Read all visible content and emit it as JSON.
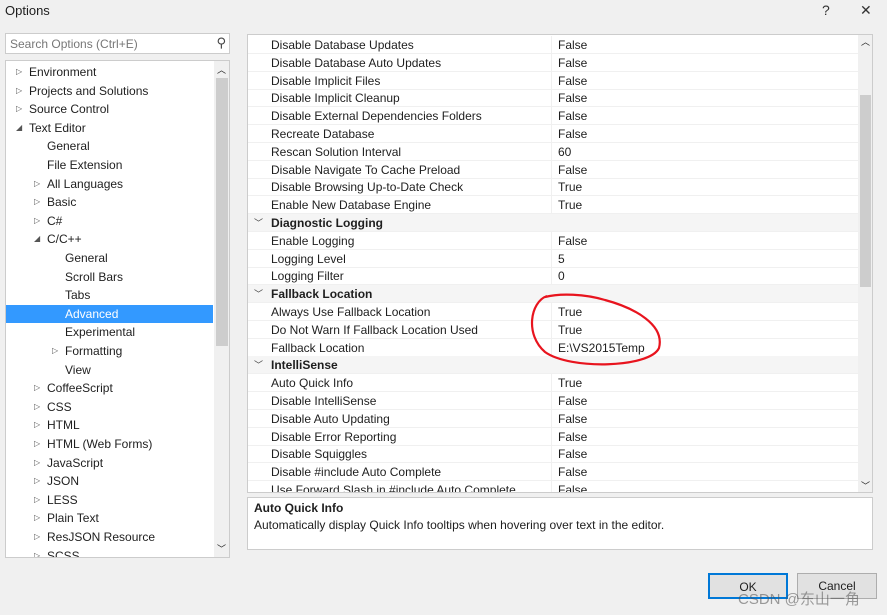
{
  "window": {
    "title": "Options",
    "help": "?",
    "close": "✕"
  },
  "search": {
    "placeholder": "Search Options (Ctrl+E)"
  },
  "tree": [
    {
      "label": "Environment",
      "level": 0,
      "state": "collapsed"
    },
    {
      "label": "Projects and Solutions",
      "level": 0,
      "state": "collapsed"
    },
    {
      "label": "Source Control",
      "level": 0,
      "state": "collapsed"
    },
    {
      "label": "Text Editor",
      "level": 0,
      "state": "expanded"
    },
    {
      "label": "General",
      "level": 1,
      "state": "leaf"
    },
    {
      "label": "File Extension",
      "level": 1,
      "state": "leaf"
    },
    {
      "label": "All Languages",
      "level": 1,
      "state": "collapsed"
    },
    {
      "label": "Basic",
      "level": 1,
      "state": "collapsed"
    },
    {
      "label": "C#",
      "level": 1,
      "state": "collapsed"
    },
    {
      "label": "C/C++",
      "level": 1,
      "state": "expanded"
    },
    {
      "label": "General",
      "level": 2,
      "state": "leaf"
    },
    {
      "label": "Scroll Bars",
      "level": 2,
      "state": "leaf"
    },
    {
      "label": "Tabs",
      "level": 2,
      "state": "leaf"
    },
    {
      "label": "Advanced",
      "level": 2,
      "state": "leaf",
      "selected": true
    },
    {
      "label": "Experimental",
      "level": 2,
      "state": "leaf"
    },
    {
      "label": "Formatting",
      "level": 2,
      "state": "collapsed"
    },
    {
      "label": "View",
      "level": 2,
      "state": "leaf"
    },
    {
      "label": "CoffeeScript",
      "level": 1,
      "state": "collapsed"
    },
    {
      "label": "CSS",
      "level": 1,
      "state": "collapsed"
    },
    {
      "label": "HTML",
      "level": 1,
      "state": "collapsed"
    },
    {
      "label": "HTML (Web Forms)",
      "level": 1,
      "state": "collapsed"
    },
    {
      "label": "JavaScript",
      "level": 1,
      "state": "collapsed"
    },
    {
      "label": "JSON",
      "level": 1,
      "state": "collapsed"
    },
    {
      "label": "LESS",
      "level": 1,
      "state": "collapsed"
    },
    {
      "label": "Plain Text",
      "level": 1,
      "state": "collapsed"
    },
    {
      "label": "ResJSON Resource",
      "level": 1,
      "state": "collapsed"
    },
    {
      "label": "SCSS",
      "level": 1,
      "state": "collapsed"
    }
  ],
  "grid": [
    {
      "name": "Disable Database Updates",
      "value": "False"
    },
    {
      "name": "Disable Database Auto Updates",
      "value": "False"
    },
    {
      "name": "Disable Implicit Files",
      "value": "False"
    },
    {
      "name": "Disable Implicit Cleanup",
      "value": "False"
    },
    {
      "name": "Disable External Dependencies Folders",
      "value": "False"
    },
    {
      "name": "Recreate Database",
      "value": "False"
    },
    {
      "name": "Rescan Solution Interval",
      "value": "60"
    },
    {
      "name": "Disable Navigate To Cache Preload",
      "value": "False"
    },
    {
      "name": "Disable Browsing Up-to-Date Check",
      "value": "True"
    },
    {
      "name": "Enable New Database Engine",
      "value": "True"
    },
    {
      "category": "Diagnostic Logging"
    },
    {
      "name": "Enable Logging",
      "value": "False"
    },
    {
      "name": "Logging Level",
      "value": "5"
    },
    {
      "name": "Logging Filter",
      "value": "0"
    },
    {
      "category": "Fallback Location"
    },
    {
      "name": "Always Use Fallback Location",
      "value": "True"
    },
    {
      "name": "Do Not Warn If Fallback Location Used",
      "value": "True"
    },
    {
      "name": "Fallback Location",
      "value": "E:\\VS2015Temp"
    },
    {
      "category": "IntelliSense"
    },
    {
      "name": "Auto Quick Info",
      "value": "True"
    },
    {
      "name": "Disable IntelliSense",
      "value": "False"
    },
    {
      "name": "Disable Auto Updating",
      "value": "False"
    },
    {
      "name": "Disable Error Reporting",
      "value": "False"
    },
    {
      "name": "Disable Squiggles",
      "value": "False"
    },
    {
      "name": "Disable #include Auto Complete",
      "value": "False"
    },
    {
      "name": "Use Forward Slash in #include Auto Complete",
      "value": "False"
    }
  ],
  "description": {
    "title": "Auto Quick Info",
    "text": "Automatically display Quick Info tooltips when hovering over text in the editor."
  },
  "buttons": {
    "ok": "OK",
    "cancel": "Cancel"
  },
  "watermark": "CSDN @东山一角",
  "annotation_color": "#e8141e"
}
